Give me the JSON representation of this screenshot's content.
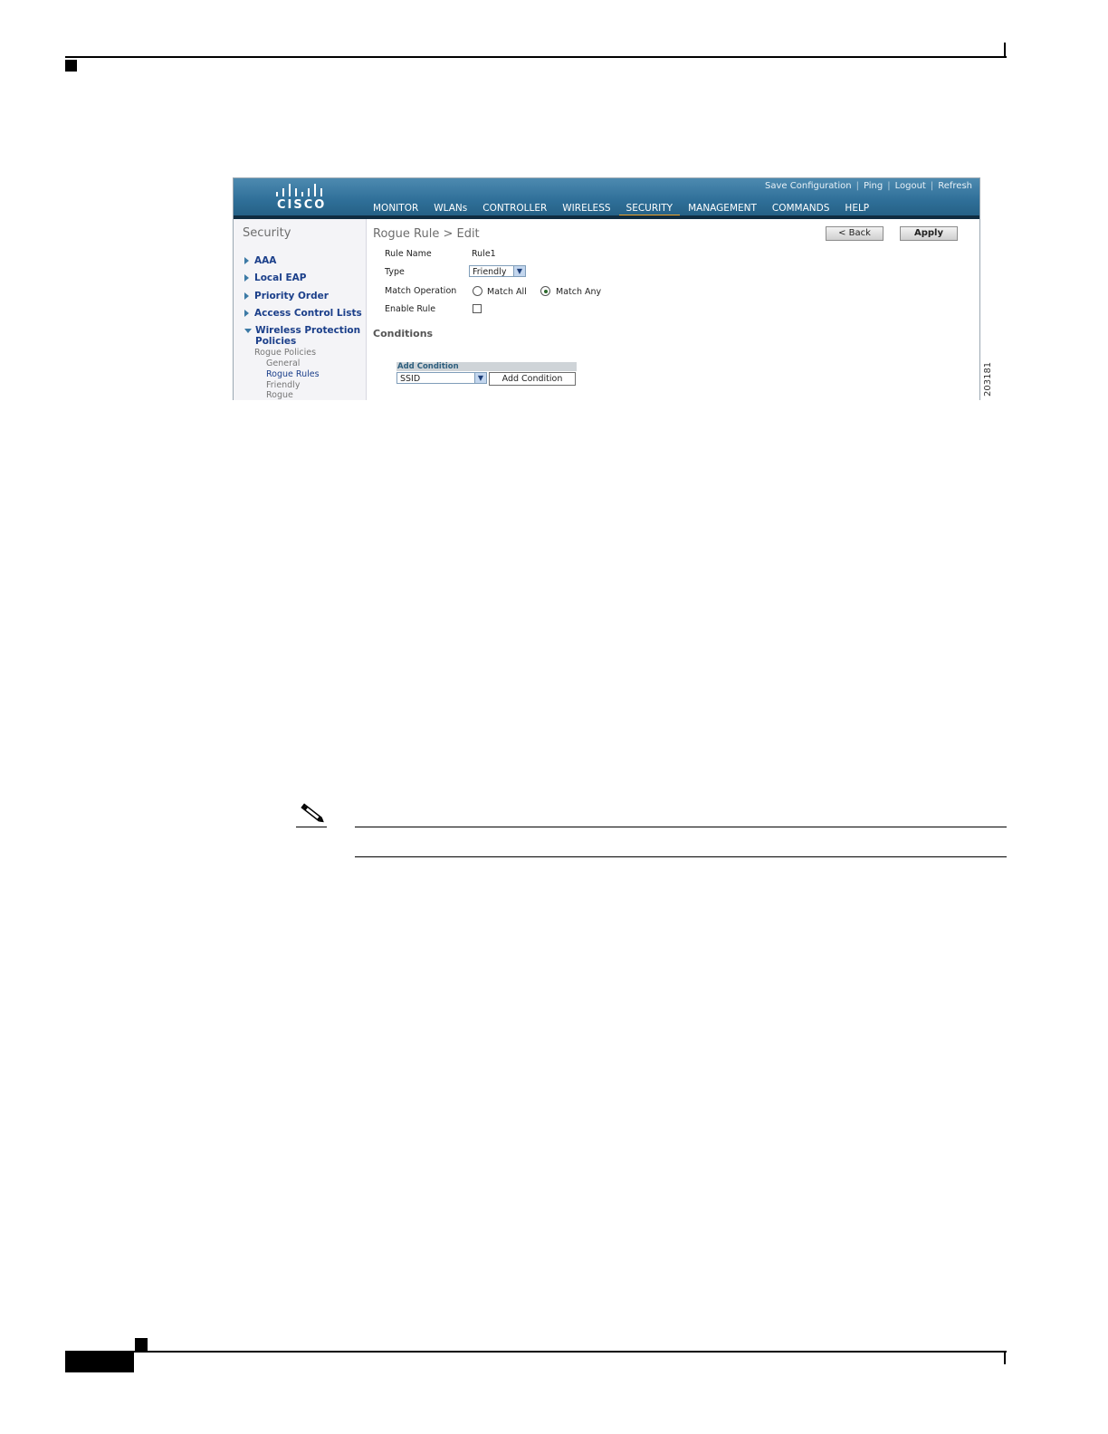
{
  "header": {
    "brand": "CISCO",
    "util_links": [
      "Save Configuration",
      "Ping",
      "Logout",
      "Refresh"
    ],
    "tabs": [
      {
        "label": "MONITOR"
      },
      {
        "label": "WLANs"
      },
      {
        "label": "CONTROLLER"
      },
      {
        "label": "WIRELESS"
      },
      {
        "label": "SECURITY",
        "active": true
      },
      {
        "label": "MANAGEMENT"
      },
      {
        "label": "COMMANDS"
      },
      {
        "label": "HELP"
      }
    ]
  },
  "sidebar": {
    "title": "Security",
    "items": [
      {
        "label": "AAA"
      },
      {
        "label": "Local EAP"
      },
      {
        "label": "Priority Order"
      },
      {
        "label": "Access Control Lists"
      },
      {
        "label": "Wireless Protection",
        "label2": "Policies",
        "expanded": true
      }
    ],
    "sub_heading": "Rogue Policies",
    "sub_items": [
      "General",
      "Rogue Rules",
      "Friendly",
      "Rogue"
    ]
  },
  "main": {
    "title": "Rogue Rule > Edit",
    "back_label": "< Back",
    "apply_label": "Apply",
    "fields": {
      "rule_name_label": "Rule Name",
      "rule_name_value": "Rule1",
      "type_label": "Type",
      "type_value": "Friendly",
      "match_label": "Match Operation",
      "match_all": "Match All",
      "match_any": "Match Any",
      "enable_label": "Enable Rule"
    },
    "conditions_title": "Conditions",
    "add_condition_header": "Add Condition",
    "condition_select": "SSID",
    "add_condition_button": "Add Condition"
  },
  "figure_number": "203181"
}
